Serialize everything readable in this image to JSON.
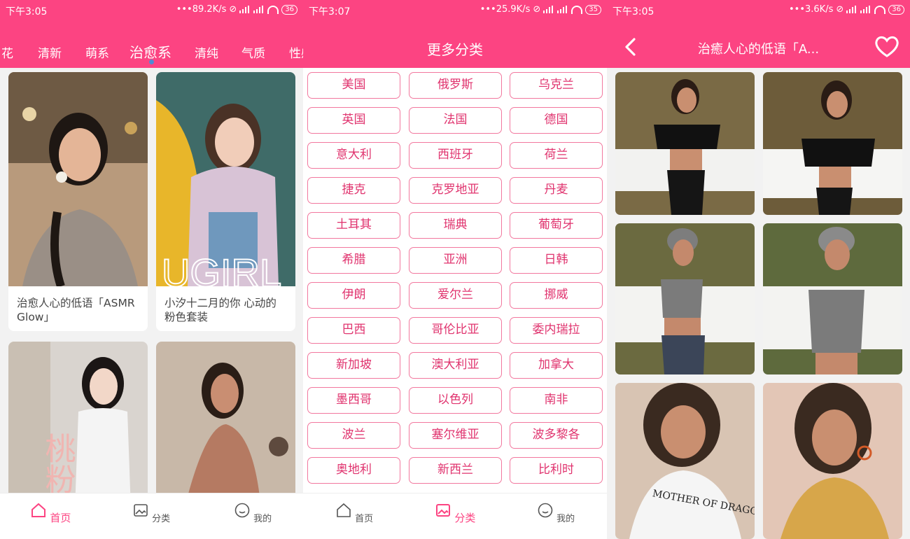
{
  "screen1": {
    "status": {
      "time": "下午3:05",
      "speed": "89.2K/s",
      "battery": "36"
    },
    "tabs": [
      "花",
      "清新",
      "萌系",
      "治愈系",
      "清纯",
      "气质",
      "性感"
    ],
    "active_tab": "治愈系",
    "cards": [
      {
        "caption": "治愈人心的低语「ASMR Glow」"
      },
      {
        "caption": "小汐十二月的你 心动的粉色套装",
        "watermark": "UGIRL"
      },
      {
        "caption": "",
        "overlay_text": "桃粉の"
      },
      {
        "caption": ""
      }
    ],
    "nav": {
      "home": "首页",
      "category": "分类",
      "mine": "我的"
    }
  },
  "screen2": {
    "status": {
      "time": "下午3:07",
      "speed": "25.9K/s",
      "battery": "35"
    },
    "title": "更多分类",
    "categories": [
      "美国",
      "俄罗斯",
      "乌克兰",
      "英国",
      "法国",
      "德国",
      "意大利",
      "西班牙",
      "荷兰",
      "捷克",
      "克罗地亚",
      "丹麦",
      "土耳其",
      "瑞典",
      "葡萄牙",
      "希腊",
      "亚洲",
      "日韩",
      "伊朗",
      "爱尔兰",
      "挪威",
      "巴西",
      "哥伦比亚",
      "委内瑞拉",
      "新加坡",
      "澳大利亚",
      "加拿大",
      "墨西哥",
      "以色列",
      "南非",
      "波兰",
      "塞尔维亚",
      "波多黎各",
      "奥地利",
      "新西兰",
      "比利时"
    ],
    "nav": {
      "home": "首页",
      "category": "分类",
      "mine": "我的"
    }
  },
  "screen3": {
    "status": {
      "time": "下午3:05",
      "speed": "3.6K/s",
      "battery": "36"
    },
    "title": "治癒人心的低语「A...",
    "photo_text": "MOTHER OF DRAGONS"
  },
  "colors": {
    "brand": "#fc4482",
    "chip_border": "#f2789e",
    "chip_text": "#e0336e",
    "tab_indicator": "#4f8bd6"
  }
}
